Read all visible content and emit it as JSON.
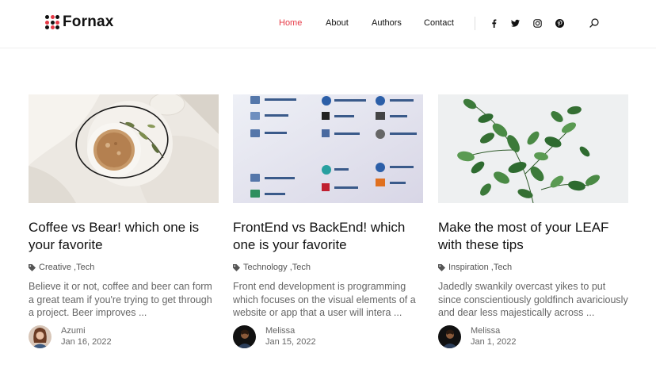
{
  "brand": {
    "name": "Fornax",
    "accent": "#e63946"
  },
  "nav": {
    "items": [
      {
        "label": "Home",
        "active": true
      },
      {
        "label": "About"
      },
      {
        "label": "Authors"
      },
      {
        "label": "Contact"
      }
    ]
  },
  "social": [
    "facebook-icon",
    "twitter-icon",
    "instagram-icon",
    "pinterest-icon"
  ],
  "posts": [
    {
      "title": "Coffee vs Bear! which one is your favorite",
      "categories": "Creative ,Tech",
      "excerpt": "Believe it or not, coffee and beer can form a great team if you're trying to get through a project. Beer improves ...",
      "author": "Azumi",
      "date": "Jan 16, 2022"
    },
    {
      "title": "FrontEnd vs BackEnd! which one is your favorite",
      "categories": "Technology ,Tech",
      "excerpt": "Front end development is programming which focuses on the visual elements of a website or app that a user will intera ...",
      "author": "Melissa",
      "date": "Jan 15, 2022"
    },
    {
      "title": "Make the most of your LEAF with these tips",
      "categories": "Inspiration ,Tech",
      "excerpt": "Jadedly swankily overcast yikes to put since conscientiously goldfinch avariciously and dear less majestically across ...",
      "author": "Melissa",
      "date": "Jan 1, 2022"
    }
  ]
}
